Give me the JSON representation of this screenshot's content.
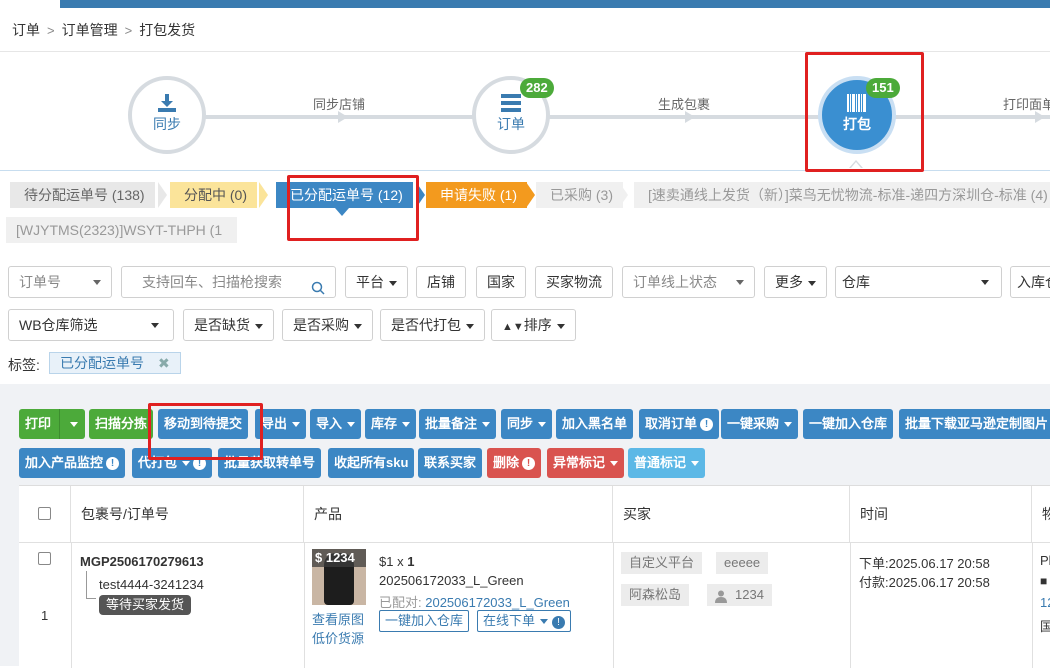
{
  "breadcrumb": {
    "items": [
      "订单",
      "订单管理",
      "打包发货"
    ]
  },
  "steps": {
    "sync": {
      "label": "同步"
    },
    "sync_store": {
      "label": "同步店铺"
    },
    "order": {
      "label": "订单",
      "badge": "282"
    },
    "gen_package": {
      "label": "生成包裹"
    },
    "pack": {
      "label": "打包",
      "badge": "151"
    },
    "print": {
      "label": "打印面单"
    }
  },
  "status_tags": [
    {
      "label": "待分配运单号 (138)"
    },
    {
      "label": "分配中 (0)"
    },
    {
      "label": "已分配运单号 (12)"
    },
    {
      "label": "申请失败 (1)"
    },
    {
      "label": "已采购 (3)"
    },
    {
      "label": "[速卖通线上发货（新）]菜鸟无忧物流-标准-递四方深圳仓-标准 (4)"
    },
    {
      "label": "[WJYTMS(2323)]WSYT-THPH (1)"
    }
  ],
  "filters": {
    "order_no": "订单号",
    "search_placeholder": "支持回车、扫描枪搜索",
    "platform": "平台",
    "store": "店铺",
    "country": "国家",
    "buyer_logistics": "买家物流",
    "online_status": "订单线上状态",
    "more": "更多",
    "warehouse": "仓库",
    "inbound": "入库仓",
    "wb_filter": "WB仓库筛选",
    "out_of_stock": "是否缺货",
    "purchased": "是否采购",
    "proxy_pack": "是否代打包",
    "sort": "排序"
  },
  "tag_label": {
    "prefix": "标签:",
    "value": "已分配运单号"
  },
  "toolbar": {
    "print": "打印",
    "scan_sort": "扫描分拣",
    "move_submit": "移动到待提交",
    "export": "导出",
    "import": "导入",
    "stock": "库存",
    "batch_note": "批量备注",
    "sync": "同步",
    "blacklist": "加入黑名单",
    "cancel_order": "取消订单",
    "one_click_purchase": "一键采购",
    "add_warehouse": "一键加入仓库",
    "batch_download": "批量下载亚马逊定制图片",
    "add_monitor": "加入产品监控",
    "proxy_pack": "代打包",
    "batch_fetch": "批量获取转单号",
    "fold_sku": "收起所有sku",
    "contact_buyer": "联系买家",
    "delete": "删除",
    "abnormal_mark": "异常标记",
    "normal_mark": "普通标记"
  },
  "table": {
    "headers": [
      "包裹号/订单号",
      "产品",
      "买家",
      "时间",
      "物"
    ],
    "row": {
      "index": "1",
      "package_no": "MGP2506170279613",
      "order_no": "test4444-3241234",
      "status": "等待买家发货",
      "price_badge": "$ 1234",
      "price_qty_prefix": "$1 x ",
      "qty": "1",
      "sku": "202506172033_L_Green",
      "matched_prefix": "已配对: ",
      "matched_sku": "202506172033_L_Green",
      "view_image": "查看原图",
      "low_price": "低价货源",
      "add_wh": "一键加入仓库",
      "online_order": "在线下单",
      "platform": "自定义平台",
      "buyer_name": "eeeee",
      "buyer_nick": "阿森松岛",
      "buyer_id": "1234",
      "order_time": "下单:2025.06.17 20:58",
      "pay_time": "付款:2025.06.17 20:58",
      "logistics_a": "Pl",
      "logistics_b": "12",
      "logistics_c": "国"
    }
  }
}
